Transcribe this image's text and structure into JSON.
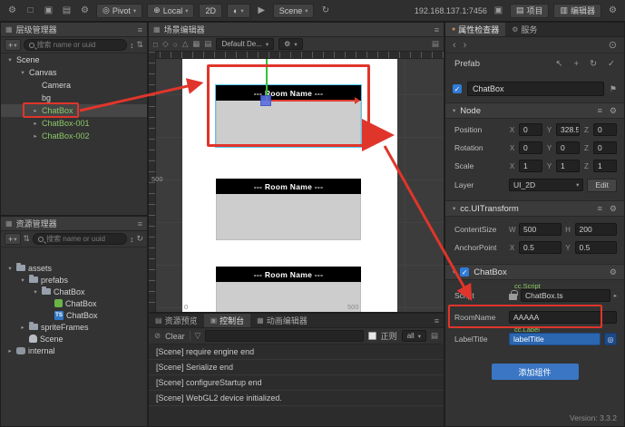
{
  "axis": {
    "x": "X",
    "y": "Y",
    "z": "Z",
    "w": "W",
    "h": "H"
  },
  "accent": {
    "annotation_red": "#e0352b",
    "selection_blue": "#2b66b0",
    "prefab_green": "#8cc868"
  },
  "icons": {
    "gear": "⚙",
    "menu": "≡",
    "caret_down": "▾",
    "caret_right": "▸",
    "plus": "+",
    "refresh": "↻",
    "globe": "◐",
    "pivot": "◎",
    "local": "⊕",
    "play": "▶",
    "copy": "▣",
    "project": "▤",
    "editor": "▥",
    "back": "‹",
    "forward": "›",
    "check": "✓",
    "flag": "⚑",
    "clear": "⊘",
    "funnel": "▽",
    "target": "◎",
    "link": "↖",
    "updown": "↕",
    "sort": "⇅",
    "grid": "▦",
    "list": "▤",
    "expand": "□",
    "lock": "⊙",
    "export": "▤",
    "tool_a": "□",
    "tool_b": "◇",
    "tool_c": "○",
    "tool_d": "△",
    "tool_e": "▦",
    "tool_f": "▤",
    "dot": "●"
  },
  "toolbar": {
    "pivot_label": "Pivot",
    "local_label": "Local",
    "mode_2d_label": "2D",
    "scene_dropdown": "Scene",
    "ip_address": "192.168.137.1:7456",
    "project_label": "项目",
    "editor_label": "编辑器"
  },
  "hierarchy": {
    "title": "层级管理器",
    "search_placeholder": "搜索 name or uuid",
    "nodes": [
      {
        "label": "Scene",
        "arrow": "▾"
      },
      {
        "label": "Canvas",
        "arrow": "▾"
      },
      {
        "label": "Camera",
        "arrow": ""
      },
      {
        "label": "bg",
        "arrow": ""
      },
      {
        "label": "ChatBox",
        "arrow": "▸"
      },
      {
        "label": "ChatBox-001",
        "arrow": "▸"
      },
      {
        "label": "ChatBox-002",
        "arrow": "▸"
      }
    ]
  },
  "assets": {
    "title": "资源管理器",
    "search_placeholder": "搜索 name or uuid",
    "items": [
      {
        "label": "assets",
        "arrow": "▾"
      },
      {
        "label": "prefabs",
        "arrow": "▾"
      },
      {
        "label": "ChatBox",
        "arrow": "▾"
      },
      {
        "label": "ChatBox",
        "arrow": ""
      },
      {
        "label": "ChatBox",
        "arrow": "",
        "badge": "TS"
      },
      {
        "label": "spriteFrames",
        "arrow": "▸"
      },
      {
        "label": "Scene",
        "arrow": ""
      },
      {
        "label": "internal",
        "arrow": "▸"
      }
    ]
  },
  "scene_panel": {
    "title": "场景编辑器",
    "gizmo_dropdown": "Default De...",
    "room_title": "--- Room Name ---",
    "ruler_left_label": "500",
    "coord_zero": "0",
    "coord_500": "500"
  },
  "console": {
    "tab_preview": "资源预览",
    "tab_console": "控制台",
    "tab_animation": "动画编辑器",
    "clear_label": "Clear",
    "regex_label": "正则",
    "filter_value": "all",
    "logs": [
      "[Scene] require engine end",
      "[Scene] Serialize end",
      "[Scene] configureStartup end",
      "[Scene] WebGL2 device initialized."
    ]
  },
  "inspector": {
    "tab_properties": "属性检查器",
    "tab_services": "服务",
    "prefab_label": "Prefab",
    "node_name": "ChatBox",
    "node_section_title": "Node",
    "position_label": "Position",
    "position": {
      "x": "0",
      "y": "328.5",
      "z": "0"
    },
    "rotation_label": "Rotation",
    "rotation": {
      "x": "0",
      "y": "0",
      "z": "0"
    },
    "scale_label": "Scale",
    "scale": {
      "x": "1",
      "y": "1",
      "z": "1"
    },
    "layer_label": "Layer",
    "layer_value": "UI_2D",
    "edit_label": "Edit",
    "uitransform_title": "cc.UITransform",
    "contentsize_label": "ContentSize",
    "contentsize": {
      "w": "500",
      "h": "200"
    },
    "anchor_label": "AnchorPoint",
    "anchor": {
      "x": "0.5",
      "y": "0.5"
    },
    "chatbox_title": "ChatBox",
    "script_label": "Script",
    "script_type_tag": "cc.Script",
    "script_value": "ChatBox.ts",
    "roomname_label": "RoomName",
    "roomname_value": "AAAAA",
    "labeltitle_label": "LabelTitle",
    "labeltitle_type_tag": "cc.Label",
    "labeltitle_value": "labelTitle",
    "add_component_label": "添加组件",
    "version": "Version: 3.3.2"
  }
}
